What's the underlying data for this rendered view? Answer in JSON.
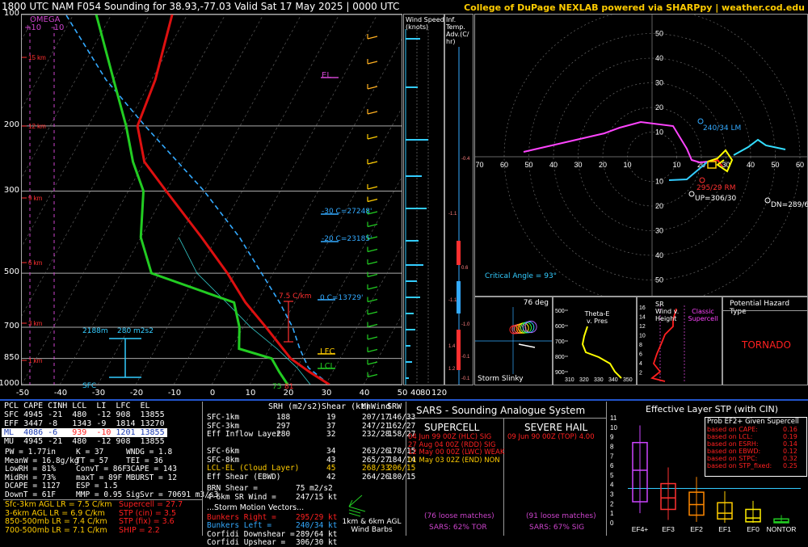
{
  "header": {
    "title": "1800 UTC NAM F054 Sounding for 38.93,-77.03 Valid  Sat 17 May 2025 | 0000 UTC",
    "credit": "College of DuPage NEXLAB powered via SHARPpy | weather.cod.edu"
  },
  "colors": {
    "accent_yellow": "#ffcc00",
    "temp": "#ff2020",
    "dew": "#22cc22",
    "omega": "#cc44cc",
    "cyan": "#33aaff",
    "grid": "#888888"
  },
  "skewt": {
    "omega_label": "OMEGA",
    "omega_ticks": [
      "+10",
      "-10"
    ],
    "pressure_labels": [
      {
        "p": 100,
        "label": "100"
      },
      {
        "p": 200,
        "label": "200"
      },
      {
        "p": 300,
        "label": "300"
      },
      {
        "p": 500,
        "label": "500"
      },
      {
        "p": 700,
        "label": "700"
      },
      {
        "p": 850,
        "label": "850"
      },
      {
        "p": 1000,
        "label": "1000"
      }
    ],
    "height_labels": [
      "15 km",
      "12 km",
      "9 km",
      "6 km",
      "3 km",
      "1 km",
      "SFC"
    ],
    "temp_ticks": [
      "-50",
      "-40",
      "-30",
      "-20",
      "-10",
      "0",
      "10",
      "20",
      "30",
      "40",
      "50"
    ],
    "annotations": {
      "el": "EL",
      "lfc": "LFC",
      "lcl": "LCL",
      "m30": "-30 C=27248'",
      "m20": "-20 C=23185'",
      "zero": "0 C=13729'",
      "lapse": "7.5 C/km",
      "srh_height": "2188m",
      "srh_val": "280 m2s2",
      "sfc": "SFC",
      "sfc_t": "75",
      "sfc_td": "81"
    },
    "chart_data": {
      "type": "line",
      "title": "",
      "xlabel": "",
      "ylabel": "",
      "ylim": [
        1000,
        100
      ],
      "xlim": [
        -50,
        50
      ],
      "series": [
        {
          "name": "",
          "points": [
            [
              1000,
              31
            ],
            [
              925,
              24
            ],
            [
              850,
              17
            ],
            [
              700,
              6
            ],
            [
              600,
              -3
            ],
            [
              500,
              -12
            ],
            [
              400,
              -24
            ],
            [
              300,
              -40
            ],
            [
              250,
              -50
            ],
            [
              200,
              -57
            ],
            [
              150,
              -59
            ],
            [
              100,
              -64
            ]
          ]
        },
        {
          "name": "",
          "points": [
            [
              1000,
              20
            ],
            [
              925,
              16
            ],
            [
              850,
              12
            ],
            [
              800,
              2
            ],
            [
              700,
              -1
            ],
            [
              600,
              -6
            ],
            [
              500,
              -32
            ],
            [
              400,
              -40
            ],
            [
              300,
              -46
            ],
            [
              250,
              -53
            ],
            [
              200,
              -60
            ],
            [
              150,
              -70
            ],
            [
              100,
              -84
            ]
          ]
        }
      ]
    }
  },
  "wind_panel": {
    "title": "Wind Speed (knots)",
    "ticks": [
      "40",
      "80",
      "120"
    ]
  },
  "inf_panel": {
    "title": "Inf. Temp. Adv.(C/ hr)",
    "ticks": [
      "-0.4",
      "-1.1",
      "0.6",
      "-1.1",
      "-1.0",
      "1.4",
      "-0.1",
      "1.2",
      "-0.1"
    ]
  },
  "hodograph": {
    "x_ticks": [
      "70",
      "60",
      "50",
      "40",
      "30",
      "20",
      "10",
      "10",
      "20",
      "30",
      "40",
      "50",
      "60",
      "70"
    ],
    "y_ticks": [
      "60",
      "50",
      "40",
      "30",
      "20",
      "10",
      "10",
      "20",
      "30",
      "40",
      "50",
      "60"
    ],
    "lm": "240/34 LM",
    "rm": "295/29 RM",
    "up": "UP=306/30",
    "dn": "DN=289/64",
    "critical_angle": "Critical Angle = 93°"
  },
  "storm_slinky": {
    "deg": "76 deg",
    "label": "Storm Slinky"
  },
  "theta": {
    "title": "Theta-E v. Pres",
    "levels": [
      "500",
      "600",
      "700",
      "800",
      "900"
    ],
    "x_ticks": [
      "310",
      "320",
      "330",
      "340",
      "350"
    ]
  },
  "srwind": {
    "title": "SR Wind v. Height",
    "classic": "Classic Supercell",
    "levels": [
      "16",
      "14",
      "12",
      "10",
      "8",
      "6",
      "4",
      "2"
    ]
  },
  "hazard": {
    "title": "Potential Hazard Type",
    "value": "TORNADO"
  },
  "thermo": {
    "headers": [
      "PCL",
      "CAPE",
      "CINH",
      "LCL",
      "LI",
      "LFC",
      "EL"
    ],
    "rows": [
      [
        "SFC",
        "4945",
        "-21",
        "480",
        "-12",
        "908",
        "13855"
      ],
      [
        "EFF",
        "3447",
        "-8",
        "1343",
        "-9",
        "1814",
        "13270"
      ],
      [
        "ML",
        "4086",
        "-6",
        "939",
        "-10",
        "1201",
        "13855"
      ],
      [
        "MU",
        "4945",
        "-21",
        "480",
        "-12",
        "908",
        "13855"
      ]
    ],
    "indices": [
      [
        "PW = 1.77in",
        "K = 37",
        "WNDG = 1.8"
      ],
      [
        "MeanW = 16.8g/kg",
        "TT = 57",
        "TEI = 36"
      ],
      [
        "LowRH = 81%",
        "ConvT = 86F",
        "3CAPE = 143"
      ],
      [
        "MidRH = 73%",
        "maxT = 89F",
        "MBURST = 12"
      ],
      [
        "DCAPE = 1127",
        "ESP = 1.5",
        ""
      ],
      [
        "DownT = 61F",
        "MMP = 0.95",
        "SigSvr = 70691 m3/s3"
      ]
    ],
    "lapse": [
      "Sfc-3km AGL LR = 7.5 C/km",
      "3-6km AGL LR = 6.9 C/km",
      "850-500mb LR = 7.4 C/km",
      "700-500mb LR = 7.1 C/km"
    ],
    "composite": [
      "Supercell = 27.7",
      "STP (cin) = 3.5",
      "STP (fix) = 3.6",
      "SHIP = 2.2"
    ]
  },
  "kinematic": {
    "headers": [
      "SRH (m2/s2)",
      "Shear (kt)",
      "MnWind",
      "SRW"
    ],
    "rows": [
      [
        "SFC-1km",
        "188",
        "19",
        "207/17",
        "146/33"
      ],
      [
        "SFC-3km",
        "297",
        "37",
        "247/21",
        "162/27"
      ],
      [
        "Eff Inflow Layer",
        "280",
        "32",
        "232/28",
        "158/27"
      ],
      [
        "",
        "",
        "",
        "",
        ""
      ],
      [
        "SFC-6km",
        "",
        "34",
        "263/26",
        "178/15"
      ],
      [
        "SFC-8km",
        "",
        "43",
        "265/27",
        "184/14"
      ],
      [
        "LCL-EL (Cloud Layer)",
        "",
        "45",
        "268/33",
        "206/15"
      ],
      [
        "Eff Shear (EBWD)",
        "",
        "42",
        "264/26",
        "180/15"
      ]
    ],
    "brn": [
      "BRN Shear = ",
      "75 m2/s2"
    ],
    "sr46": [
      "4-6km SR Wind = ",
      "247/15 kt"
    ],
    "vectors_title": "...Storm Motion Vectors...",
    "vectors": [
      [
        "Bunkers Right = ",
        "295/29 kt"
      ],
      [
        "Bunkers Left = ",
        "240/34 kt"
      ],
      [
        "Corfidi Downshear = ",
        "289/64 kt"
      ],
      [
        "Corfidi Upshear = ",
        "306/30 kt"
      ]
    ],
    "barbs_label": "1km & 6km AGL Wind Barbs"
  },
  "sars": {
    "title": "SARS - Sounding Analogue System",
    "supercell_title": "SUPERCELL",
    "supercell": [
      "04 Jun 99 00Z (HLC) SIG",
      "27 Aug 04 00Z (RDD) SIG",
      "12 May 00 00Z (LWC) WEAK",
      "01 May 03 02Z (END) NON"
    ],
    "supercell_matches": "(76 loose matches)",
    "supercell_tor": "SARS: 62% TOR",
    "hail_title": "SEVERE HAIL",
    "hail": [
      "09 Jun 90 00Z (TOP) 4.00"
    ],
    "hail_matches": "(91 loose matches)",
    "hail_sig": "SARS: 67% SIG"
  },
  "stp": {
    "title": "Effective Layer STP (with CIN)",
    "y_ticks": [
      "11",
      "10",
      "9",
      "8",
      "7",
      "6",
      "5",
      "4",
      "3",
      "2",
      "1",
      "0"
    ],
    "categories": [
      "EF4+",
      "EF3",
      "EF2",
      "EF1",
      "EF0",
      "NONTOR"
    ],
    "prob_title": "Prob EF2+ Given Supercell",
    "prob": [
      [
        "based on CAPE:",
        "0.16"
      ],
      [
        "based on LCL:",
        "0.19"
      ],
      [
        "based on ESRH:",
        "0.14"
      ],
      [
        "based on EBWD:",
        "0.12"
      ],
      [
        "based on STPC:",
        "0.32"
      ],
      [
        "based on STP_fixed:",
        "0.25"
      ]
    ],
    "box_data": [
      {
        "name": "EF4+",
        "min": 1.0,
        "q1": 2.2,
        "med": 5.5,
        "q3": 8.4,
        "max": 10.2
      },
      {
        "name": "EF3",
        "min": 0.3,
        "q1": 1.4,
        "med": 2.6,
        "q3": 4.1,
        "max": 5.8
      },
      {
        "name": "EF2",
        "min": 0.1,
        "q1": 0.8,
        "med": 1.9,
        "q3": 3.2,
        "max": 4.8
      },
      {
        "name": "EF1",
        "min": 0.0,
        "q1": 0.4,
        "med": 1.0,
        "q3": 2.1,
        "max": 3.3
      },
      {
        "name": "EF0",
        "min": 0.0,
        "q1": 0.1,
        "med": 0.5,
        "q3": 1.4,
        "max": 2.3
      },
      {
        "name": "NONTOR",
        "min": 0.0,
        "q1": 0.0,
        "med": 0.1,
        "q3": 0.4,
        "max": 0.8
      }
    ]
  }
}
